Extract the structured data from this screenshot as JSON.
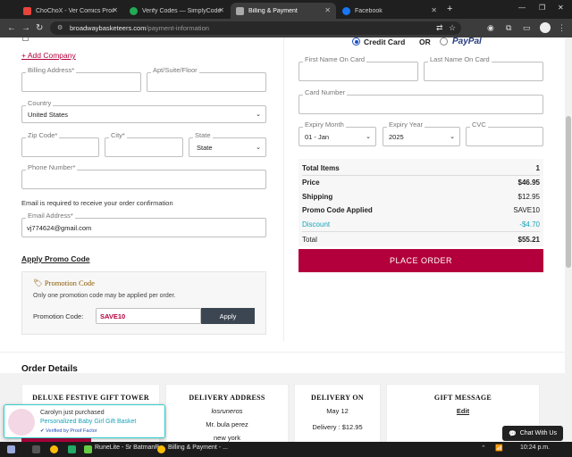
{
  "browser": {
    "tabs": [
      {
        "label": "ChoChoX - Ver Comics Promo C...",
        "favicon_color": "#e8443a",
        "active": false
      },
      {
        "label": "Verify Codes — SimplyCodes",
        "favicon_color": "#22aa55",
        "active": false
      },
      {
        "label": "Billing & Payment",
        "favicon_color": "#aaaaaa",
        "active": true
      },
      {
        "label": "Facebook",
        "favicon_color": "#1877f2",
        "active": false
      }
    ],
    "url_domain": "broadwaybasketeers.com",
    "url_path": "/payment-information"
  },
  "billing": {
    "add_company": "+ Add Company",
    "billing_address_label": "Billing Address*",
    "apt_label": "Apt/Suite/Floor",
    "country_label": "Country",
    "country_value": "United States",
    "zip_label": "Zip Code*",
    "city_label": "City*",
    "state_label": "State",
    "state_value": "State",
    "phone_label": "Phone Number*",
    "email_note": "Email is required to receive your order confirmation",
    "email_label": "Email Address*",
    "email_value": "vj774624@gmail.com",
    "apply_promo_link": "Apply Promo Code"
  },
  "promo": {
    "title": "Promotion Code",
    "note": "Only one promotion code may be applied per order.",
    "field_label": "Promotion Code:",
    "code_value": "SAVE10",
    "apply_button": "Apply"
  },
  "payment": {
    "credit_card_label": "Credit Card",
    "or_label": "OR",
    "paypal_label": "PayPal",
    "first_name_label": "First Name On Card",
    "last_name_label": "Last Name On Card",
    "card_number_label": "Card Number",
    "expiry_month_label": "Expiry Month",
    "expiry_month_value": "01 - Jan",
    "expiry_year_label": "Expiry Year",
    "expiry_year_value": "2025",
    "cvc_label": "CVC"
  },
  "summary": {
    "rows": [
      {
        "label": "Total Items",
        "value": "1"
      },
      {
        "label": "Price",
        "value": "$46.95"
      },
      {
        "label": "Shipping",
        "value": "$12.95"
      },
      {
        "label": "Promo Code Applied",
        "value": "SAVE10"
      },
      {
        "label": "Discount",
        "value": "-$4.70"
      },
      {
        "label": "Total",
        "value": "$55.21"
      }
    ],
    "place_order": "PLACE ORDER"
  },
  "order_details": {
    "heading": "Order Details",
    "product_title": "DELUXE FESTIVE GIFT TOWER",
    "delivery_address_title": "DELIVERY ADDRESS",
    "address_line1": "losruneros",
    "address_line2": "Mr. bula perez",
    "address_line3": "new york",
    "delivery_on_title": "DELIVERY ON",
    "delivery_date": "May 12",
    "delivery_cost": "Delivery : $12.95",
    "gift_message_title": "GIFT MESSAGE",
    "edit_link": "Edit"
  },
  "proof_popup": {
    "line1": "Carolyn just purchased",
    "line2": "Personalized Baby Girl Gift Basket",
    "verified": "Verified by Proof Factor"
  },
  "chat_button": "Chat With Us",
  "taskbar": {
    "items": [
      {
        "label": "RuneLite - Sr BatmanP"
      },
      {
        "label": "Billing & Payment - ..."
      }
    ],
    "time": "10:24 p.m."
  },
  "colors": {
    "accent": "#b3003c",
    "discount": "#1aa3b8",
    "paypal": "#253b80"
  }
}
